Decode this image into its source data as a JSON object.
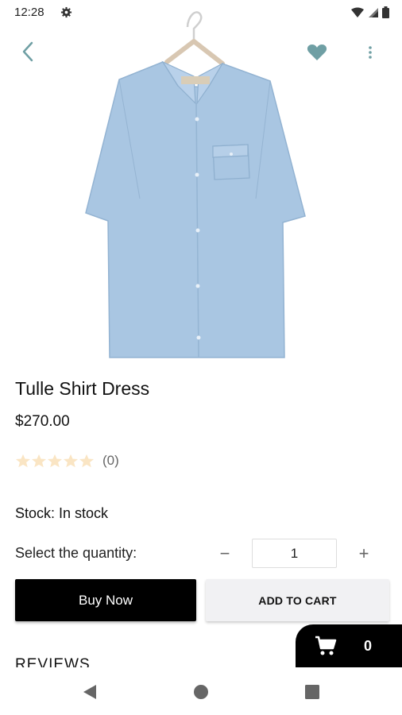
{
  "status_bar": {
    "time": "12:28",
    "icons": [
      "gear-icon",
      "wifi-icon",
      "signal-icon",
      "battery-icon"
    ]
  },
  "toolbar": {
    "back_icon": "chevron-left-icon",
    "favorite_icon": "heart-icon",
    "more_icon": "more-vert-icon",
    "accent_color": "#6f9fa4"
  },
  "product": {
    "image": "light blue shirt dress on hanger",
    "title": "Tulle Shirt Dress",
    "price": "$270.00",
    "rating": {
      "stars_filled": 0,
      "stars_total": 5,
      "count_label": "(0)"
    },
    "stock_label": "Stock: In stock"
  },
  "quantity": {
    "label": "Select the quantity:",
    "minus": "−",
    "value": "1",
    "plus": "+"
  },
  "actions": {
    "buy_now": "Buy Now",
    "add_to_cart": "ADD TO CART"
  },
  "reviews": {
    "heading": "REVIEWS"
  },
  "cart": {
    "icon": "cart-icon",
    "count": "0"
  },
  "nav": {
    "icons": [
      "back-triangle-icon",
      "home-circle-icon",
      "recents-square-icon"
    ]
  }
}
